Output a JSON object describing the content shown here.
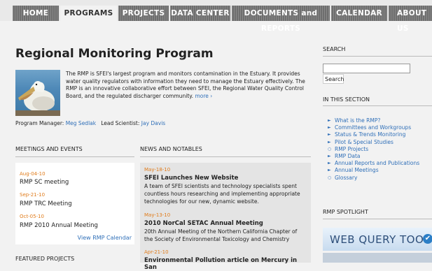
{
  "nav": {
    "tabs": [
      "HOME",
      "PROGRAMS",
      "PROJECTS",
      "DATA CENTER",
      "DOCUMENTS and REPORTS",
      "CALENDAR",
      "ABOUT US"
    ]
  },
  "main": {
    "title": "Regional Monitoring Program",
    "intro": "The RMP is SFEI's largest program and monitors contamination in the Estuary. It provides water quality regulators with information they need to manage the Estuary effectively. The RMP is an innovative collaborative effort between SFEI, the Regional Water Quality Control Board, and the regulated discharger community.",
    "more_link": "more ›",
    "manager_label": "Program Manager:",
    "manager_name": "Meg Sedlak",
    "lead_label": "Lead Scientist:",
    "lead_name": "Jay Davis"
  },
  "meetings": {
    "heading": "MEETINGS AND EVENTS",
    "items": [
      {
        "date": "Aug-04-10",
        "title": "RMP SC meeting"
      },
      {
        "date": "Sep-21-10",
        "title": "RMP TRC Meeting"
      },
      {
        "date": "Oct-05-10",
        "title": "RMP 2010 Annual Meeting"
      }
    ],
    "calendar_link": "View RMP Calendar"
  },
  "news": {
    "heading": "NEWS AND NOTABLES",
    "items": [
      {
        "date": "May-18-10",
        "title": "SFEI Launches New Website",
        "body": "A team of SFEI scientists and technology specialists spent countless hours researching and implementing appropriate technologies for our new, dynamic website."
      },
      {
        "date": "May-13-10",
        "title": "2010 NorCal SETAC Annual Meeting",
        "body": "20th Annual Meeting of the Northern California Chapter of the Society of Environmental Toxicology and Chemistry"
      },
      {
        "date": "Apr-21-10",
        "title": "Environmental Pollution article on Mercury in San",
        "body": ""
      }
    ]
  },
  "featured": {
    "heading": "FEATURED PROJECTS"
  },
  "sidebar": {
    "search_heading": "SEARCH",
    "search_value": "",
    "search_button": "Search",
    "section_heading": "IN THIS SECTION",
    "section_items": [
      {
        "label": "What is the RMP?",
        "bullet": "arrow"
      },
      {
        "label": "Committees and Workgroups",
        "bullet": "arrow"
      },
      {
        "label": "Status & Trends Monitoring",
        "bullet": "arrow"
      },
      {
        "label": "Pilot & Special Studies",
        "bullet": "arrow"
      },
      {
        "label": "RMP Projects",
        "bullet": "circle"
      },
      {
        "label": "RMP Data",
        "bullet": "arrow"
      },
      {
        "label": "Annual Reports and Publications",
        "bullet": "arrow"
      },
      {
        "label": "Annual Meetings",
        "bullet": "arrow"
      },
      {
        "label": "Glossary",
        "bullet": "circle"
      }
    ],
    "spotlight_heading": "RMP SPOTLIGHT",
    "spotlight_banner": "WEB QUERY TOOL",
    "spotlight_check": "✔"
  }
}
